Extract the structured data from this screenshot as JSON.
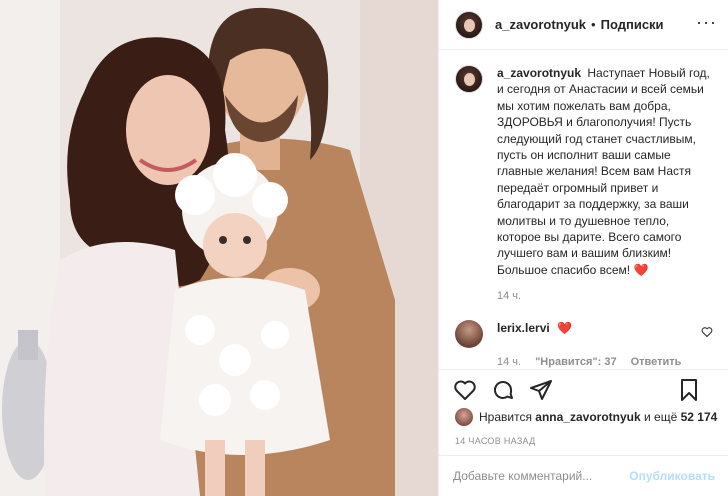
{
  "post": {
    "username": "a_zavorotnyuk",
    "follow_label": "Подписки",
    "more_icon": "more-horizontal-icon"
  },
  "caption": {
    "username": "a_zavorotnyuk",
    "text": "Наступает Новый год, и сегодня от Анастасии и всей семьи мы хотим пожелать вам добра, ЗДОРОВЬЯ и благополучия! Пусть следующий год станет счастливым, пусть он исполнит ваши самые главные желания! Всем вам Настя передаёт огромный привет и благодарит за поддержку, за ваши молитвы и то душевное тепло, которое вы дарите. Всего самого лучшего вам и вашим близким! Большое спасибо всем!",
    "heart": "❤️",
    "time": "14 ч."
  },
  "comments": [
    {
      "username": "lerix.lervi",
      "text": "❤️",
      "time": "14 ч.",
      "likes": "\"Нравится\": 37",
      "reply": "Ответить"
    }
  ],
  "likes": {
    "prefix": "Нравится",
    "user": "anna_zavorotnyuk",
    "middle": "и ещё",
    "count": "52 174"
  },
  "timestamp": "14 ЧАСОВ НАЗАД",
  "comment_input": {
    "placeholder": "Добавьте комментарий...",
    "publish_label": "Опубликовать"
  },
  "colors": {
    "heart": "#ed4956",
    "publish_disabled": "#b2dffc",
    "muted": "#8e8e8e"
  }
}
